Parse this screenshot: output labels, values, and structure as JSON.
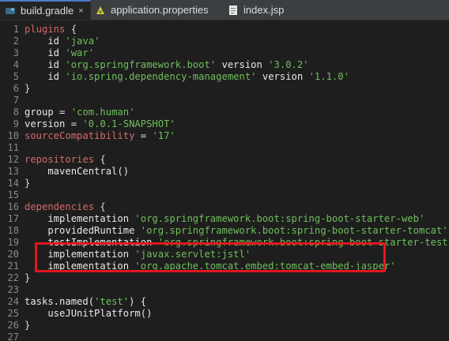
{
  "tabs": [
    {
      "label": "build.gradle",
      "icon": "gradle-icon",
      "active": true
    },
    {
      "label": "application.properties",
      "icon": "properties-icon",
      "active": false
    },
    {
      "label": "index.jsp",
      "icon": "jsp-file-icon",
      "active": false
    }
  ],
  "tab_close_glyph": "×",
  "lines": [
    {
      "n": "1",
      "parts": [
        {
          "t": "plugins",
          "c": "block-red"
        },
        {
          "t": " {",
          "c": "brace"
        }
      ]
    },
    {
      "n": "2",
      "parts": [
        {
          "t": "    id ",
          "c": "kw"
        },
        {
          "t": "'java'",
          "c": "str"
        }
      ]
    },
    {
      "n": "3",
      "parts": [
        {
          "t": "    id ",
          "c": "kw"
        },
        {
          "t": "'war'",
          "c": "str"
        }
      ]
    },
    {
      "n": "4",
      "parts": [
        {
          "t": "    id ",
          "c": "kw"
        },
        {
          "t": "'org.springframework.boot'",
          "c": "str"
        },
        {
          "t": " version ",
          "c": "kw"
        },
        {
          "t": "'3.0.2'",
          "c": "str"
        }
      ]
    },
    {
      "n": "5",
      "parts": [
        {
          "t": "    id ",
          "c": "kw"
        },
        {
          "t": "'io.spring.dependency-management'",
          "c": "str"
        },
        {
          "t": " version ",
          "c": "kw"
        },
        {
          "t": "'1.1.0'",
          "c": "str"
        }
      ]
    },
    {
      "n": "6",
      "parts": [
        {
          "t": "}",
          "c": "brace"
        }
      ]
    },
    {
      "n": "7",
      "parts": []
    },
    {
      "n": "8",
      "parts": [
        {
          "t": "group = ",
          "c": "kw"
        },
        {
          "t": "'com.human'",
          "c": "str"
        }
      ]
    },
    {
      "n": "9",
      "parts": [
        {
          "t": "version = ",
          "c": "kw"
        },
        {
          "t": "'0.0.1-SNAPSHOT'",
          "c": "str"
        }
      ]
    },
    {
      "n": "10",
      "parts": [
        {
          "t": "sourceCompatibility",
          "c": "block-red"
        },
        {
          "t": " = ",
          "c": "kw"
        },
        {
          "t": "'17'",
          "c": "str"
        }
      ]
    },
    {
      "n": "11",
      "parts": []
    },
    {
      "n": "12",
      "parts": [
        {
          "t": "repositories",
          "c": "block-red"
        },
        {
          "t": " {",
          "c": "brace"
        }
      ]
    },
    {
      "n": "13",
      "parts": [
        {
          "t": "    mavenCentral()",
          "c": "kw"
        }
      ]
    },
    {
      "n": "14",
      "parts": [
        {
          "t": "}",
          "c": "brace"
        }
      ]
    },
    {
      "n": "15",
      "parts": []
    },
    {
      "n": "16",
      "parts": [
        {
          "t": "dependencies",
          "c": "block-red"
        },
        {
          "t": " {",
          "c": "brace"
        }
      ]
    },
    {
      "n": "17",
      "parts": [
        {
          "t": "    implementation ",
          "c": "kw"
        },
        {
          "t": "'org.springframework.boot:spring-boot-starter-web'",
          "c": "str"
        }
      ]
    },
    {
      "n": "18",
      "parts": [
        {
          "t": "    providedRuntime ",
          "c": "kw"
        },
        {
          "t": "'org.springframework.boot:spring-boot-starter-tomcat'",
          "c": "str"
        }
      ]
    },
    {
      "n": "19",
      "parts": [
        {
          "t": "    testImplementation ",
          "c": "kw"
        },
        {
          "t": "'org.springframework.boot:spring-boot-starter-test'",
          "c": "str"
        }
      ]
    },
    {
      "n": "20",
      "parts": [
        {
          "t": "    implementation ",
          "c": "kw"
        },
        {
          "t": "'javax.servlet:jstl'",
          "c": "str"
        }
      ]
    },
    {
      "n": "21",
      "parts": [
        {
          "t": "    implementation ",
          "c": "kw"
        },
        {
          "t": "'org.apache.tomcat.embed:tomcat-embed-jasper'",
          "c": "str"
        }
      ]
    },
    {
      "n": "22",
      "parts": [
        {
          "t": "}",
          "c": "brace"
        }
      ]
    },
    {
      "n": "23",
      "parts": []
    },
    {
      "n": "24",
      "parts": [
        {
          "t": "tasks.named(",
          "c": "kw"
        },
        {
          "t": "'test'",
          "c": "str"
        },
        {
          "t": ") {",
          "c": "kw"
        }
      ]
    },
    {
      "n": "25",
      "parts": [
        {
          "t": "    useJUnitPlatform()",
          "c": "kw"
        }
      ]
    },
    {
      "n": "26",
      "parts": [
        {
          "t": "}",
          "c": "brace"
        }
      ]
    },
    {
      "n": "27",
      "parts": []
    }
  ],
  "colors": {
    "keyword_block": "#d36a6a",
    "string": "#6fbf5c",
    "text": "#e6e6e6",
    "highlight_box": "#e0171f",
    "active_tab_accent": "#4a7cc9"
  }
}
